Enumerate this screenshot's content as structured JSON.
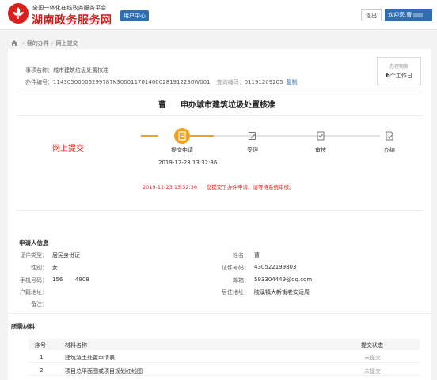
{
  "header": {
    "subtitle": "全国一体化在线政务服务平台",
    "title": "湖南政务服务网",
    "user_center": "用户中心",
    "logout": "退出",
    "welcome": "欢迎您,曹"
  },
  "breadcrumb": {
    "items": [
      "我的办件",
      "网上提交"
    ]
  },
  "meta": {
    "item_name_label": "事项名称：",
    "item_name": "城市建筑垃圾处置核准",
    "case_no_label": "办件编号：",
    "case_no": "11430500006299787K3000117014000281912230W001",
    "query_label": "查询编码：",
    "query_code": "01191209205",
    "copy": "复制",
    "limit_label": "办理期限",
    "limit_value": "6",
    "limit_unit": "个工作日"
  },
  "title": {
    "surname": "曹",
    "text": "申办城市建筑垃圾处置核准"
  },
  "status": "网上提交",
  "steps": [
    {
      "label": "提交申请",
      "icon": "document-icon"
    },
    {
      "label": "受理",
      "icon": "edit-icon"
    },
    {
      "label": "审核",
      "icon": "check-icon"
    },
    {
      "label": "办结",
      "icon": "finish-icon"
    }
  ],
  "step_time": "2019-12-23 13:32:36",
  "log": {
    "time": "2019-12-23 13:32:36",
    "message": "您提交了办件申请，请等待系统审核。"
  },
  "applicant": {
    "section_title": "申请人信息",
    "left": [
      {
        "label": "证件类型：",
        "value": "居民身份证"
      },
      {
        "label": "性别：",
        "value": "女"
      },
      {
        "label": "手机号码：",
        "value": "156       4908"
      },
      {
        "label": "户籍地址：",
        "value": ""
      },
      {
        "label": "备注：",
        "value": ""
      }
    ],
    "right": [
      {
        "label": "姓名：",
        "value": "曹"
      },
      {
        "label": "证件号码：",
        "value": "430522199803"
      },
      {
        "label": "邮箱：",
        "value": "593304449@qq.com"
      },
      {
        "label": "居住地址：",
        "value": "陂溪镇大新街老安适周"
      }
    ]
  },
  "materials": {
    "section_title": "所需材料",
    "headers": [
      "序号",
      "材料名称",
      "提交状态"
    ],
    "rows": [
      {
        "no": "1",
        "name": "建筑渣土处置申请表",
        "status": "未提交"
      },
      {
        "no": "2",
        "name": "项目总平面图或项目规划红线图",
        "status": "未提交"
      }
    ]
  },
  "colors": {
    "brand_red": "#c81d1b",
    "accent_blue": "#2f6fb0",
    "step_orange": "#f0a21c",
    "alert_red": "#e2261f"
  }
}
